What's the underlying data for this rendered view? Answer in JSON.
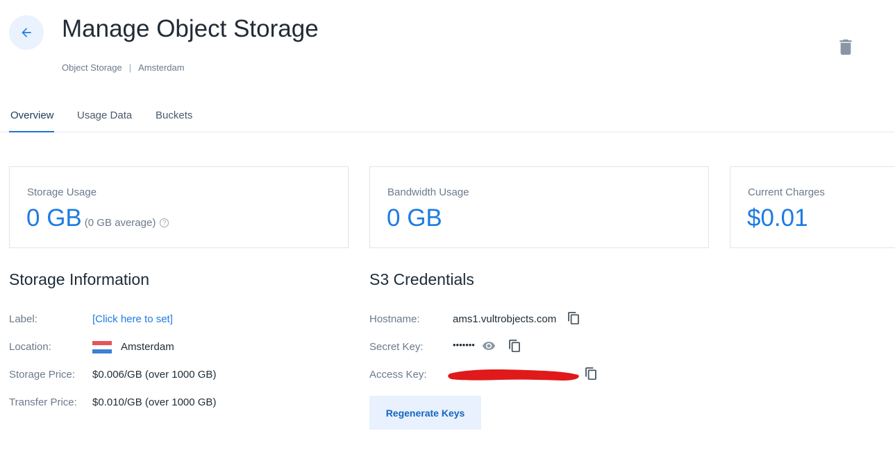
{
  "header": {
    "title": "Manage Object Storage",
    "breadcrumb": [
      "Object Storage",
      "Amsterdam"
    ],
    "breadcrumb_separator": "|"
  },
  "tabs": [
    {
      "label": "Overview",
      "active": true
    },
    {
      "label": "Usage Data",
      "active": false
    },
    {
      "label": "Buckets",
      "active": false
    }
  ],
  "cards": {
    "storage": {
      "label": "Storage Usage",
      "value": "0 GB",
      "sub": "(0 GB average)",
      "help_glyph": "?"
    },
    "bandwidth": {
      "label": "Bandwidth Usage",
      "value": "0 GB"
    },
    "charges": {
      "label": "Current Charges",
      "value": "$0.01"
    }
  },
  "storage_info": {
    "title": "Storage Information",
    "rows": [
      {
        "label": "Label:",
        "value": "[Click here to set]"
      },
      {
        "label": "Location:",
        "value": "Amsterdam"
      },
      {
        "label": "Storage Price:",
        "value": "$0.006/GB (over 1000 GB)"
      },
      {
        "label": "Transfer Price:",
        "value": "$0.010/GB (over 1000 GB)"
      }
    ]
  },
  "s3": {
    "title": "S3 Credentials",
    "hostname_label": "Hostname:",
    "hostname": "ams1.vultrobjects.com",
    "secret_label": "Secret Key:",
    "secret_masked": "•••••••",
    "access_label": "Access Key:",
    "regenerate_label": "Regenerate Keys"
  },
  "colors": {
    "accent": "#1e7be3",
    "redaction": "#e0191b",
    "flag": [
      "#e5545b",
      "#ffffff",
      "#3f7fd6"
    ]
  },
  "icons": [
    "arrow-left-icon",
    "trash-icon",
    "help-icon",
    "copy-icon",
    "eye-icon",
    "netherlands-flag-icon"
  ]
}
